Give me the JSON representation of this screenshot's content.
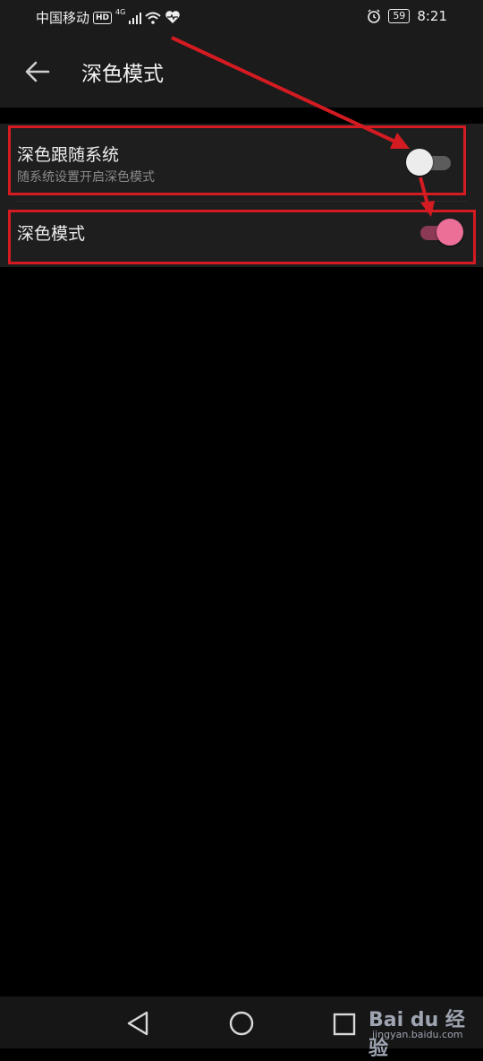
{
  "status_bar": {
    "carrier": "中国移动",
    "hd": "HD",
    "network": "4G",
    "battery": "59",
    "time": "8:21"
  },
  "header": {
    "title": "深色模式"
  },
  "settings": [
    {
      "title": "深色跟随系统",
      "subtitle": "随系统设置开启深色模式",
      "enabled": false
    },
    {
      "title": "深色模式",
      "enabled": true
    }
  ],
  "colors": {
    "accent": "#ec6f98",
    "highlight": "#d41b22",
    "background": "#000000",
    "panel": "#1e1e1e"
  },
  "watermark": {
    "main": "Bai du 经验",
    "sub": "jingyan.baidu.com"
  },
  "nav_icons": [
    "back-triangle-icon",
    "home-circle-icon",
    "recents-square-icon"
  ]
}
